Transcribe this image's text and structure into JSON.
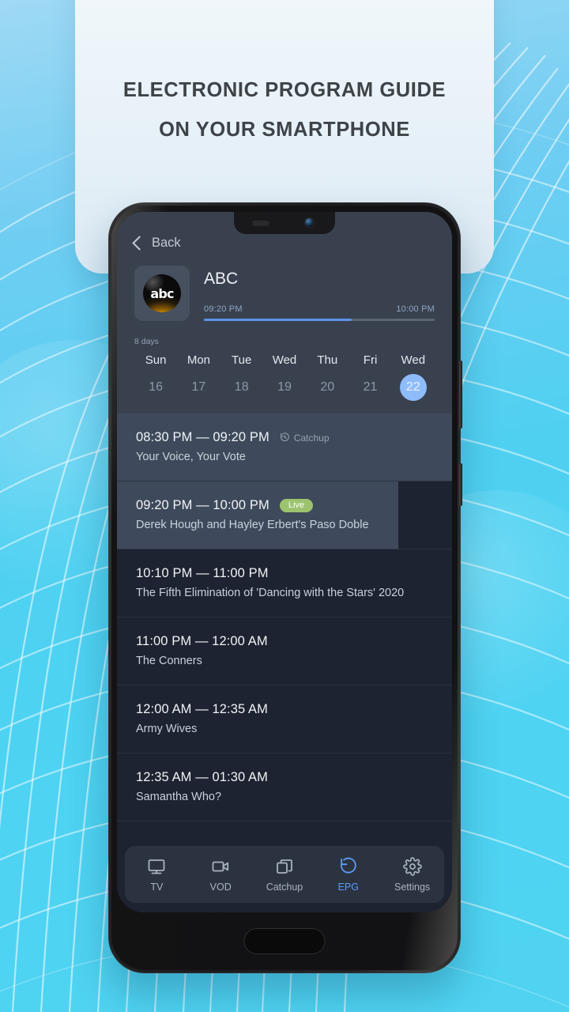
{
  "promo": {
    "headline_line1": "ELECTRONIC PROGRAM GUIDE",
    "headline_line2": "ON YOUR SMARTPHONE"
  },
  "app": {
    "back_label": "Back",
    "channel": {
      "name": "ABC",
      "logo_text": "abc",
      "now_time": "09:20 PM",
      "end_time": "10:00 PM",
      "progress_percent": 64
    },
    "date_picker": {
      "range_label": "8 days",
      "days": [
        {
          "name": "Sun",
          "number": "16",
          "selected": false
        },
        {
          "name": "Mon",
          "number": "17",
          "selected": false
        },
        {
          "name": "Tue",
          "number": "18",
          "selected": false
        },
        {
          "name": "Wed",
          "number": "19",
          "selected": false
        },
        {
          "name": "Thu",
          "number": "20",
          "selected": false
        },
        {
          "name": "Fri",
          "number": "21",
          "selected": false
        },
        {
          "name": "Wed",
          "number": "22",
          "selected": true
        }
      ]
    },
    "programs": [
      {
        "time": "08:30 PM — 09:20 PM",
        "title": "Your Voice, Your Vote",
        "badge": "Catchup",
        "badge_type": "catchup",
        "state": "past",
        "highlight_percent": 100
      },
      {
        "time": "09:20 PM — 10:00 PM",
        "title": "Derek Hough and Hayley Erbert's Paso Doble",
        "badge": "Live",
        "badge_type": "live",
        "state": "live",
        "highlight_percent": 84
      },
      {
        "time": "10:10 PM — 11:00 PM",
        "title": "The Fifth Elimination of 'Dancing with the Stars' 2020",
        "badge": "",
        "badge_type": "none",
        "state": "future",
        "highlight_percent": 0
      },
      {
        "time": "11:00 PM — 12:00 AM",
        "title": "The Conners",
        "badge": "",
        "badge_type": "none",
        "state": "future",
        "highlight_percent": 0
      },
      {
        "time": "12:00 AM — 12:35 AM",
        "title": "Army Wives",
        "badge": "",
        "badge_type": "none",
        "state": "future",
        "highlight_percent": 0
      },
      {
        "time": "12:35 AM — 01:30 AM",
        "title": "Samantha Who?",
        "badge": "",
        "badge_type": "none",
        "state": "future",
        "highlight_percent": 0
      }
    ],
    "bottom_nav": [
      {
        "label": "TV",
        "icon": "tv-icon",
        "active": false
      },
      {
        "label": "VOD",
        "icon": "video-icon",
        "active": false
      },
      {
        "label": "Catchup",
        "icon": "layers-icon",
        "active": false
      },
      {
        "label": "EPG",
        "icon": "history-icon",
        "active": true
      },
      {
        "label": "Settings",
        "icon": "gear-icon",
        "active": false
      }
    ]
  },
  "colors": {
    "accent_blue": "#5d92e8",
    "selected_day": "#8ebcfb",
    "live_green": "#9cc36e",
    "bg_cyan": "#4fd3f1",
    "panel_dark": "#1d2330",
    "panel_header": "#39414f"
  }
}
